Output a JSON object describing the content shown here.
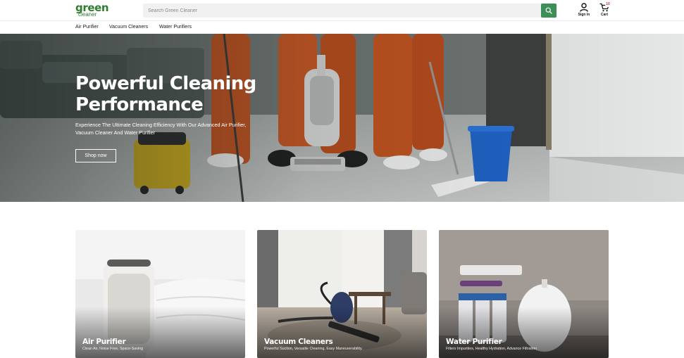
{
  "header": {
    "logo_line1": "green",
    "logo_line2": "cleaner",
    "search_placeholder": "Search Green Cleaner",
    "sign_in_label": "Sign In",
    "cart_label": "Cart",
    "cart_count": "10"
  },
  "nav": {
    "items": [
      {
        "label": "Air Purifier"
      },
      {
        "label": "Vacuum Cleaners"
      },
      {
        "label": "Water Purifiers"
      }
    ]
  },
  "hero": {
    "title": "Powerful Cleaning Performance",
    "subtitle": "Experience The Ultimate Cleaning Efficiency With Our Advanced Air Purifier, Vacuum Cleaner And Water Purifier",
    "cta_label": "Shop now"
  },
  "cards": [
    {
      "title": "Air Purifier",
      "description": "Clean Air, Noise Free, Space-Saving"
    },
    {
      "title": "Vacuum Cleaners",
      "description": "Powerful Suction, Versatile Cleaning, Easy Maneuverability."
    },
    {
      "title": "Water Purifier",
      "description": "Filters Impurities, Healthy Hydration, Advance Filtration"
    }
  ],
  "colors": {
    "brand_green": "#2e7d32",
    "search_button": "#3e8e57"
  },
  "icons": {
    "search": "search-icon",
    "user": "user-icon",
    "cart": "cart-icon"
  }
}
